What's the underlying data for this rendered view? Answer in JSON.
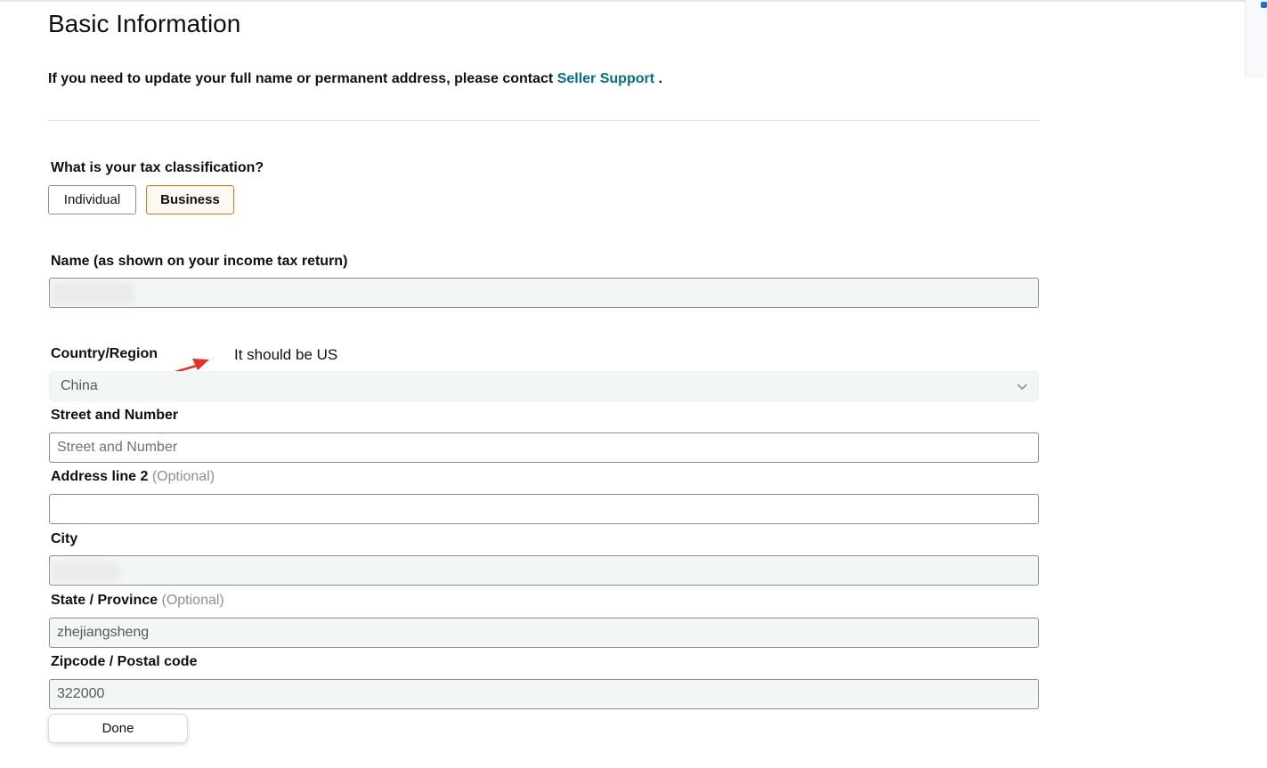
{
  "page": {
    "title": "Basic Information",
    "notice_prefix": "If you need to update your full name or permanent address, please contact",
    "notice_link": "Seller Support",
    "notice_suffix": " ."
  },
  "tax_classification": {
    "question": "What is your tax classification?",
    "options": [
      "Individual",
      "Business"
    ],
    "selected": "Business"
  },
  "form": {
    "name_label": "Name (as shown on your income tax return)",
    "name_value": "",
    "country_label": "Country/Region",
    "country_value": "China",
    "street_label": "Street and Number",
    "street_placeholder": "Street and Number",
    "address2_label": "Address line 2",
    "address2_optional": "(Optional)",
    "city_label": "City",
    "city_value": "",
    "state_label": "State / Province",
    "state_optional": "(Optional)",
    "state_value": "zhejiangsheng",
    "zip_label": "Zipcode / Postal code",
    "zip_value": "322000",
    "done_label": "Done"
  },
  "annotation": {
    "text": "It should be US",
    "color": "#e8302a"
  },
  "colors": {
    "link": "#007185",
    "selected_border": "#e47911"
  }
}
